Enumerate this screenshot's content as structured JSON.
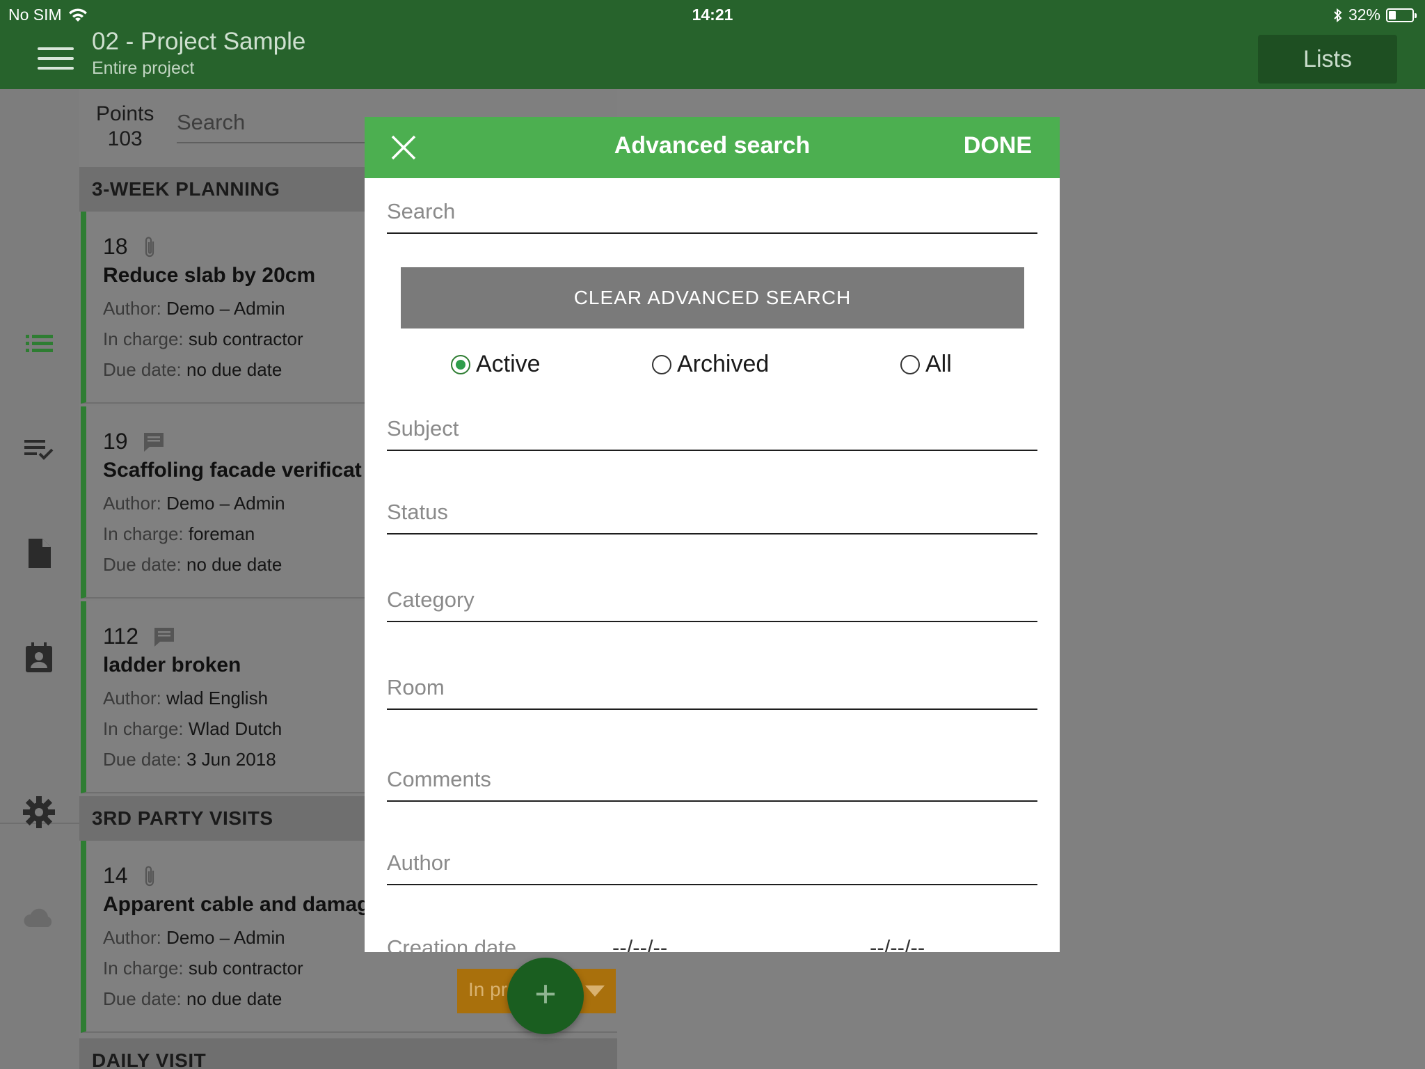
{
  "status_bar": {
    "carrier": "No SIM",
    "time": "14:21",
    "battery": "32%",
    "battery_level": 0.32
  },
  "header": {
    "title": "02 - Project Sample",
    "subtitle": "Entire project",
    "lists_label": "Lists"
  },
  "rail": {
    "icons": [
      "list-icon",
      "checklist-icon",
      "document-icon",
      "contact-badge-icon",
      "gear-icon",
      "cloud-icon"
    ]
  },
  "list_panel": {
    "points_label": "Points",
    "points_count": "103",
    "search_placeholder": "Search",
    "sections": [
      {
        "name": "3-WEEK PLANNING"
      },
      {
        "name": "3RD PARTY VISITS"
      },
      {
        "name": "DAILY VISIT"
      }
    ],
    "labels": {
      "author": "Author:",
      "in_charge": "In charge:",
      "due_date": "Due date:"
    },
    "cards": [
      {
        "number": "18",
        "icon": "paperclip-icon",
        "title": "Reduce slab by 20cm",
        "author": "Demo – Admin",
        "in_charge": "sub contractor",
        "due_date": "no due date"
      },
      {
        "number": "19",
        "icon": "comment-icon",
        "title": "Scaffoling facade verificat",
        "author": "Demo – Admin",
        "in_charge": "foreman",
        "due_date": "no due date"
      },
      {
        "number": "112",
        "icon": "comment-icon",
        "title": "ladder broken",
        "author": "wlad English",
        "in_charge": "Wlad Dutch",
        "due_date": "3 Jun 2018"
      },
      {
        "number": "14",
        "icon": "paperclip-icon",
        "title": "Apparent cable and damag",
        "author": "Demo – Admin",
        "in_charge": "sub contractor",
        "due_date": "no due date"
      }
    ],
    "status_chip": "In pr",
    "fab_label": "+"
  },
  "modal": {
    "title": "Advanced search",
    "done_label": "DONE",
    "search_placeholder": "Search",
    "clear_label": "CLEAR ADVANCED SEARCH",
    "radios": [
      {
        "label": "Active",
        "checked": true
      },
      {
        "label": "Archived",
        "checked": false
      },
      {
        "label": "All",
        "checked": false
      }
    ],
    "fields": {
      "subject": "Subject",
      "status": "Status",
      "category": "Category",
      "room": "Room",
      "comments": "Comments",
      "author": "Author"
    },
    "creation_date": {
      "label": "Creation date",
      "from": "--/--/--",
      "to": "--/--/--"
    }
  },
  "colors": {
    "header": "#27632c",
    "modal_header": "#4caf50",
    "accent": "#2e7d32",
    "clear_button": "#7a7a7a",
    "chip": "#a9700c"
  }
}
